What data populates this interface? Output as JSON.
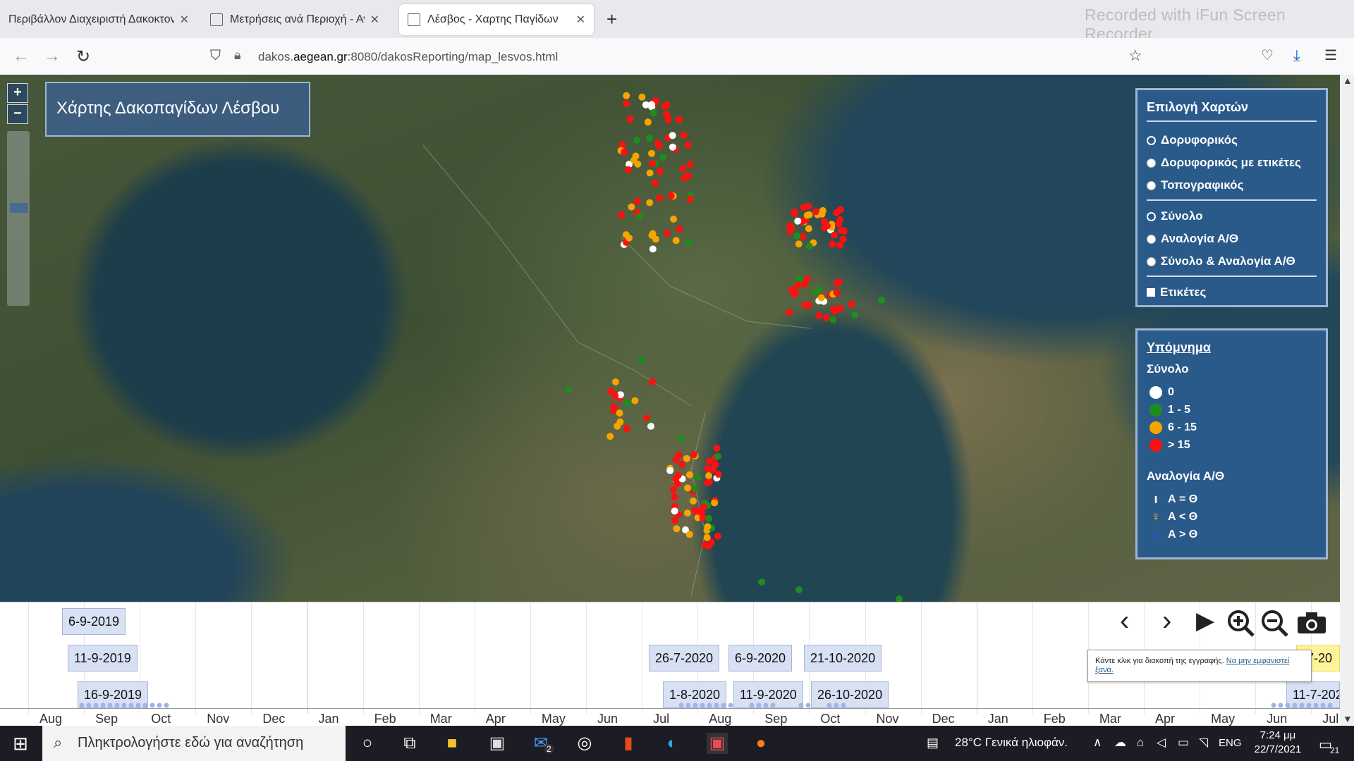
{
  "browser": {
    "tabs": [
      {
        "title": "Περιβάλλον Διαχειριστή Δακοκτον"
      },
      {
        "title": "Μετρήσεις ανά Περιοχή - Ανα"
      },
      {
        "title": "Λέσβος - Χαρτης Παγίδων"
      }
    ],
    "new_tab": "+",
    "url_prefix": "dakos.",
    "url_domain": "aegean.gr",
    "url_suffix": ":8080/dakosReporting/map_lesvos.html",
    "watermark": "Recorded with iFun Screen Recorder"
  },
  "map": {
    "title": "Χάρτης Δακοπαγίδων Λέσβου",
    "zoom_in": "+",
    "zoom_out": "−"
  },
  "layers_panel": {
    "title": "Επιλογή Χαρτών",
    "basemaps": [
      {
        "label": "Δορυφορικός",
        "selected": true
      },
      {
        "label": "Δορυφορικός με ετικέτες",
        "selected": false
      },
      {
        "label": "Τοπογραφικός",
        "selected": false
      }
    ],
    "overlays": [
      {
        "label": "Σύνολο",
        "selected": true
      },
      {
        "label": "Αναλογία Α/Θ",
        "selected": false
      },
      {
        "label": "Σύνολο & Αναλογία Α/Θ",
        "selected": false
      }
    ],
    "labels_checkbox": "Ετικέτες"
  },
  "legend": {
    "title": "Υπόμνημα",
    "total_title": "Σύνολο",
    "total_items": [
      {
        "label": "0",
        "color": "#ffffff"
      },
      {
        "label": "1 - 5",
        "color": "#1e8c1e"
      },
      {
        "label": "6 - 15",
        "color": "#f5a400"
      },
      {
        "label": "> 15",
        "color": "#ff1010"
      }
    ],
    "ratio_title": "Αναλογία Α/Θ",
    "ratio_items": [
      {
        "label": "Α = Θ",
        "symbol": "bar-icon"
      },
      {
        "label": "Α < Θ",
        "symbol": "female-icon"
      },
      {
        "label": "Α > Θ",
        "symbol": "male-icon"
      }
    ]
  },
  "timeline": {
    "dates": [
      "6-9-2019",
      "11-9-2019",
      "16-9-2019",
      "26-7-2020",
      "1-8-2020",
      "6-9-2020",
      "11-9-2020",
      "21-10-2020",
      "26-10-2020",
      "-7-20",
      "11-7-202"
    ],
    "months": [
      "Aug",
      "Sep",
      "Oct",
      "Nov",
      "Dec",
      "Jan",
      "Feb",
      "Mar",
      "Apr",
      "May",
      "Jun",
      "Jul",
      "Aug",
      "Sep",
      "Oct",
      "Nov",
      "Dec",
      "Jan",
      "Feb",
      "Mar",
      "Apr",
      "May",
      "Jun",
      "Jul"
    ],
    "tooltip_text": "Κάντε κλικ για διακοπή της εγγραφής.",
    "tooltip_link": "Να μην εμφανιστεί ξανά."
  },
  "taskbar": {
    "search_placeholder": "Πληκτρολογήστε εδώ για αναζήτηση",
    "mail_badge": "2",
    "weather": "28°C Γενικά ηλιοφάν.",
    "language": "ENG",
    "time": "7:24 μμ",
    "date": "22/7/2021",
    "notifications": "21"
  }
}
